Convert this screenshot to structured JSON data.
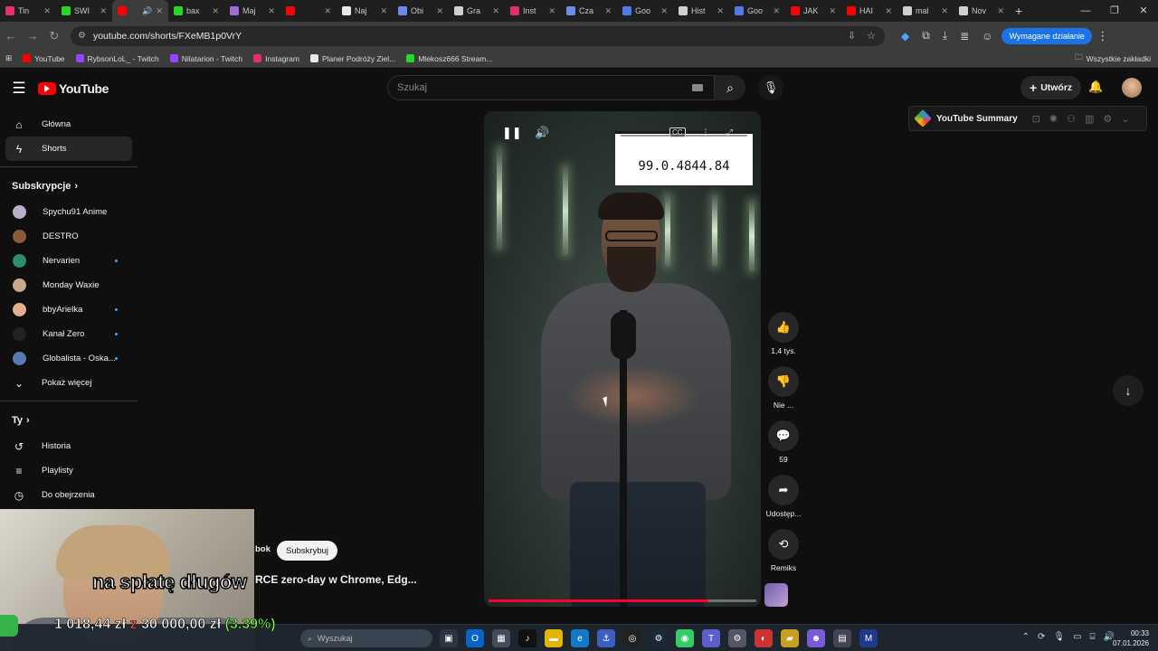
{
  "browser": {
    "tabs": [
      {
        "label": "Tin",
        "color": "#e8326f",
        "active": false
      },
      {
        "label": "SWI",
        "color": "#27d827",
        "active": false
      },
      {
        "label": "",
        "color": "#ff0000",
        "active": true
      },
      {
        "label": "bax",
        "color": "#27d827",
        "active": false
      },
      {
        "label": "Maj",
        "color": "#a36bd9",
        "active": false
      },
      {
        "label": "",
        "color": "#ff0000",
        "active": false
      },
      {
        "label": "Naj",
        "color": "#e8e8e8",
        "active": false
      },
      {
        "label": "Obi",
        "color": "#6b8ce8",
        "active": false
      },
      {
        "label": "Gra",
        "color": "#d0d0d0",
        "active": false
      },
      {
        "label": "Inst",
        "color": "#e1306c",
        "active": false
      },
      {
        "label": "Cza",
        "color": "#6b8ce8",
        "active": false
      },
      {
        "label": "Goo",
        "color": "#4f7be8",
        "active": false
      },
      {
        "label": "Hist",
        "color": "#d0d0d0",
        "active": false
      },
      {
        "label": "Goo",
        "color": "#4f7be8",
        "active": false
      },
      {
        "label": "JAK",
        "color": "#ff0000",
        "active": false
      },
      {
        "label": "HAI",
        "color": "#ff0000",
        "active": false
      },
      {
        "label": "mal",
        "color": "#d0d0d0",
        "active": false
      },
      {
        "label": "Nov",
        "color": "#d0d0d0",
        "active": false
      }
    ],
    "url": "youtube.com/shorts/FXeMB1p0VrY",
    "action_required": "Wymagane działanie",
    "bookmarks": [
      {
        "label": "YouTube",
        "color": "#ff0000"
      },
      {
        "label": "RybsonLoL_ - Twitch",
        "color": "#9146ff"
      },
      {
        "label": "Nilatarion - Twitch",
        "color": "#9146ff"
      },
      {
        "label": "Instagram",
        "color": "#e1306c"
      },
      {
        "label": "Planer Podróży Ziel...",
        "color": "#e8e8e8"
      },
      {
        "label": "Mlekosz666 Stream...",
        "color": "#27d827"
      }
    ],
    "all_bookmarks": "Wszystkie zakładki"
  },
  "youtube": {
    "logo": "YouTube",
    "search_placeholder": "Szukaj",
    "create_label": "Utwórz",
    "sidebar": {
      "main": [
        {
          "label": "Główna",
          "icon": "home-icon",
          "glyph": "⌂"
        },
        {
          "label": "Shorts",
          "icon": "shorts-icon",
          "glyph": "ϟ"
        }
      ],
      "subs_heading": "Subskrypcje",
      "subs": [
        {
          "label": "Spychu91 Anime",
          "color": "#b8b0c8",
          "dot": false
        },
        {
          "label": "DESTRO",
          "color": "#8a5a3a",
          "dot": false
        },
        {
          "label": "Nervarien",
          "color": "#2d8f6a",
          "dot": true
        },
        {
          "label": "Monday Waxie",
          "color": "#c8a888",
          "dot": false
        },
        {
          "label": "bbyArielka",
          "color": "#e0b090",
          "dot": true
        },
        {
          "label": "Kanał Zero",
          "color": "#222222",
          "dot": true
        },
        {
          "label": "Globalista - Oska...",
          "color": "#5a7ab0",
          "dot": true
        }
      ],
      "show_more": "Pokaż więcej",
      "you_heading": "Ty",
      "you": [
        {
          "label": "Historia",
          "icon": "history-icon",
          "glyph": "↺"
        },
        {
          "label": "Playlisty",
          "icon": "playlist-icon",
          "glyph": "≡"
        },
        {
          "label": "Do obejrzenia",
          "icon": "clock-icon",
          "glyph": "◷"
        }
      ]
    },
    "video": {
      "overlay_version": "99.0.4844.84",
      "progress_fraction": 0.82,
      "channel_fragment": "bok",
      "subscribe_label": "Subskrybuj",
      "title": "RCE zero-day w Chrome, Edg..."
    },
    "actions": [
      {
        "label": "1,4 tys.",
        "name": "like-button",
        "icon": "thumbs-up-icon",
        "glyph": "👍"
      },
      {
        "label": "Nie ...",
        "name": "dislike-button",
        "icon": "thumbs-down-icon",
        "glyph": "👎"
      },
      {
        "label": "59",
        "name": "comments-button",
        "icon": "comment-icon",
        "glyph": "💬"
      },
      {
        "label": "Udostęp...",
        "name": "share-button",
        "icon": "share-icon",
        "glyph": "➦"
      },
      {
        "label": "Remiks",
        "name": "remix-button",
        "icon": "remix-icon",
        "glyph": "⟲"
      }
    ],
    "summary_widget": "YouTube Summary"
  },
  "stream_overlay": {
    "caption": "na spłatę długów",
    "amount_paid": "1 018,44 zł",
    "separator": "z",
    "amount_target": "30 000,00 zł",
    "percent": "(3.39%)"
  },
  "taskbar": {
    "search_placeholder": "Wyszukaj",
    "time": "00:33",
    "date": "07.01.2026"
  }
}
